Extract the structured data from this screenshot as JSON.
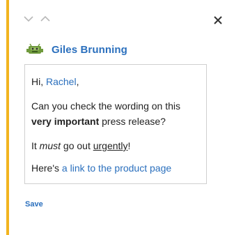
{
  "comment": {
    "author_name": "Giles Brunning",
    "greeting_prefix": "Hi, ",
    "greeting_name": "Rachel",
    "greeting_suffix": ",",
    "line2_part1": "Can you check the wording on this ",
    "line2_bold": "very important",
    "line2_part2": " press release?",
    "line3_part1": "It ",
    "line3_italic": "must",
    "line3_part2": " go out ",
    "line3_underline": "urgently",
    "line3_part3": "!",
    "line4_prefix": "Here's ",
    "line4_link": "a link to the product page"
  },
  "actions": {
    "save_label": "Save"
  },
  "icons": {
    "prev": "chevron-down-icon",
    "next": "chevron-up-icon",
    "close": "close-icon",
    "avatar": "robot-avatar-icon"
  },
  "colors": {
    "accent": "#f2b41f",
    "link": "#2a6fbd"
  }
}
